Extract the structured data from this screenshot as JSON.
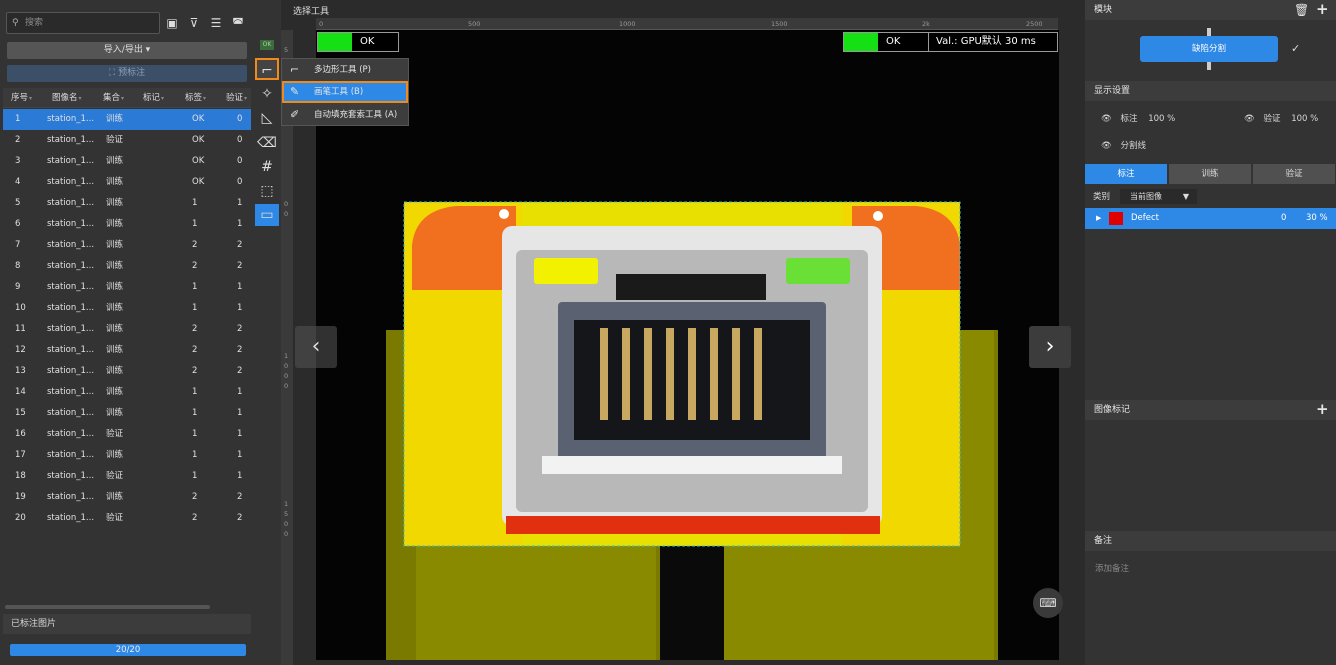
{
  "left_panel": {
    "search_placeholder": "搜索",
    "import_export": "导入/导出 ▾",
    "pre_annotate": "预标注",
    "columns": [
      "序号",
      "图像名",
      "集合",
      "标记",
      "标签",
      "验证"
    ],
    "rows": [
      {
        "idx": "1",
        "name": "station_1...",
        "set": "训练",
        "mark": "",
        "label": "OK",
        "val": "0"
      },
      {
        "idx": "2",
        "name": "station_1...",
        "set": "验证",
        "mark": "",
        "label": "OK",
        "val": "0"
      },
      {
        "idx": "3",
        "name": "station_1...",
        "set": "训练",
        "mark": "",
        "label": "OK",
        "val": "0"
      },
      {
        "idx": "4",
        "name": "station_1...",
        "set": "训练",
        "mark": "",
        "label": "OK",
        "val": "0"
      },
      {
        "idx": "5",
        "name": "station_1...",
        "set": "训练",
        "mark": "",
        "label": "1",
        "val": "1"
      },
      {
        "idx": "6",
        "name": "station_1...",
        "set": "训练",
        "mark": "",
        "label": "1",
        "val": "1"
      },
      {
        "idx": "7",
        "name": "station_1...",
        "set": "训练",
        "mark": "",
        "label": "2",
        "val": "2"
      },
      {
        "idx": "8",
        "name": "station_1...",
        "set": "训练",
        "mark": "",
        "label": "2",
        "val": "2"
      },
      {
        "idx": "9",
        "name": "station_1...",
        "set": "训练",
        "mark": "",
        "label": "1",
        "val": "1"
      },
      {
        "idx": "10",
        "name": "station_1...",
        "set": "训练",
        "mark": "",
        "label": "1",
        "val": "1"
      },
      {
        "idx": "11",
        "name": "station_1...",
        "set": "训练",
        "mark": "",
        "label": "2",
        "val": "2"
      },
      {
        "idx": "12",
        "name": "station_1...",
        "set": "训练",
        "mark": "",
        "label": "2",
        "val": "2"
      },
      {
        "idx": "13",
        "name": "station_1...",
        "set": "训练",
        "mark": "",
        "label": "2",
        "val": "2"
      },
      {
        "idx": "14",
        "name": "station_1...",
        "set": "训练",
        "mark": "",
        "label": "1",
        "val": "1"
      },
      {
        "idx": "15",
        "name": "station_1...",
        "set": "训练",
        "mark": "",
        "label": "1",
        "val": "1"
      },
      {
        "idx": "16",
        "name": "station_1...",
        "set": "验证",
        "mark": "",
        "label": "1",
        "val": "1"
      },
      {
        "idx": "17",
        "name": "station_1...",
        "set": "训练",
        "mark": "",
        "label": "1",
        "val": "1"
      },
      {
        "idx": "18",
        "name": "station_1...",
        "set": "验证",
        "mark": "",
        "label": "1",
        "val": "1"
      },
      {
        "idx": "19",
        "name": "station_1...",
        "set": "训练",
        "mark": "",
        "label": "2",
        "val": "2"
      },
      {
        "idx": "20",
        "name": "station_1...",
        "set": "验证",
        "mark": "",
        "label": "2",
        "val": "2"
      }
    ],
    "annotated_header": "已标注图片",
    "progress_text": "20/20"
  },
  "tool_column": {
    "ok_badge": "OK"
  },
  "popup_menu": {
    "items": [
      "多边形工具 (P)",
      "画笔工具 (B)",
      "自动填充套索工具 (A)"
    ]
  },
  "canvas": {
    "title": "选择工具",
    "ruler_top": [
      "0",
      "500",
      "1000",
      "1500",
      "2k",
      "2500"
    ],
    "ruler_left": [
      "5",
      "0",
      "0",
      "1",
      "0",
      "0",
      "0",
      "1",
      "5",
      "0",
      "0"
    ],
    "status_left": "OK",
    "status_right": "OK",
    "val_text": "Val.: GPU默认 30 ms",
    "prev_icon": "‹",
    "next_icon": "›"
  },
  "right_panel": {
    "module_header": "模块",
    "module_button": "缺陷分割",
    "display_header": "显示设置",
    "anno_label": "标注",
    "anno_pct": "100 %",
    "val_label": "验证",
    "val_pct": "100 %",
    "segline_label": "分割线",
    "tabs": [
      "标注",
      "训练",
      "验证"
    ],
    "category_label": "类别",
    "category_value": "当前图像",
    "defect_name": "Defect",
    "defect_count": "0",
    "defect_pct": "30 %",
    "image_mark_header": "图像标记",
    "notes_header": "备注",
    "notes_placeholder": "添加备注"
  },
  "colors": {
    "accent": "#2e88e6",
    "highlight": "#f08a1a",
    "ok_green": "#14e014",
    "defect_red": "#e00000"
  }
}
